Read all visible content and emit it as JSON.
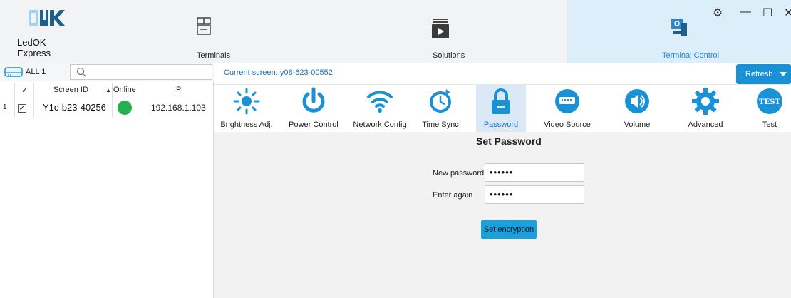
{
  "app": {
    "name": "LedOK Express"
  },
  "nav": {
    "terminals": "Terminals",
    "solutions": "Solutions",
    "terminal_control": "Terminal Control"
  },
  "window_controls": {
    "settings": "⚙",
    "minimize": "—",
    "maximize": "☐",
    "close": "✕"
  },
  "left_panel": {
    "filter_label": "ALL 1",
    "search_placeholder": "",
    "columns": [
      "✓",
      "Screen ID",
      "Online",
      "IP"
    ],
    "rows": [
      {
        "index": "1",
        "checked": "✓",
        "screen_id": "Y1c-b23-40256",
        "online": true,
        "ip": "192.168.1.103"
      }
    ]
  },
  "header": {
    "current_screen": "Current screen: y08-623-00552",
    "refresh_label": "Refresh"
  },
  "toolbar": [
    {
      "label": "Brightness Adj."
    },
    {
      "label": "Power Control"
    },
    {
      "label": "Network Config"
    },
    {
      "label": "Time Sync"
    },
    {
      "label": "Password"
    },
    {
      "label": "Video Source"
    },
    {
      "label": "Volume"
    },
    {
      "label": "Advanced"
    },
    {
      "label": "Test"
    }
  ],
  "password_form": {
    "title": "Set Password",
    "new_password_label": "New password",
    "new_password_value": "••••••",
    "enter_again_label": "Enter again",
    "enter_again_value": "••••••",
    "submit_label": "Set encryption"
  },
  "colors": {
    "accent": "#1a90d5",
    "online": "#22b14c",
    "active_tab": "#ddeefb"
  }
}
